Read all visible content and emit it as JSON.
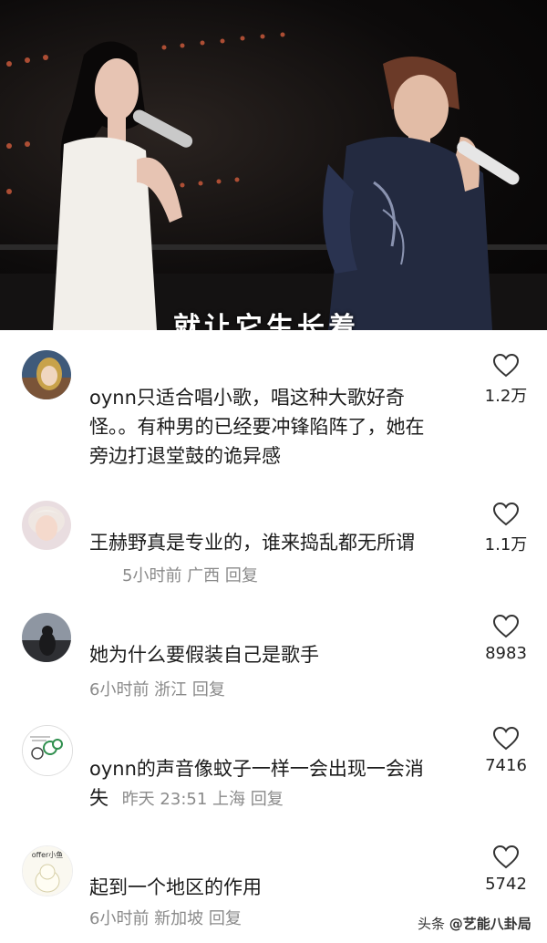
{
  "video": {
    "caption": "就让它生长着"
  },
  "comments": [
    {
      "text_lines": [
        "oynn只适合唱小歌，唱这种大歌好奇",
        "怪。。有种男的已经要冲锋陷阵了，她在",
        "旁边打退堂鼓的诡异感"
      ],
      "meta": "",
      "likes": "1.2万"
    },
    {
      "text_lines": [
        "王赫野真是专业的，谁来捣乱都无所谓"
      ],
      "meta": "5小时前 广西 回复",
      "likes": "1.1万"
    },
    {
      "text_lines": [
        "她为什么要假装自己是歌手"
      ],
      "meta": "6小时前 浙江 回复",
      "likes": "8983"
    },
    {
      "text_lines": [
        "oynn的声音像蚊子一样一会出现一会消",
        "失"
      ],
      "meta": "昨天 23:51 上海 回复",
      "likes": "7416"
    },
    {
      "text_lines": [
        "起到一个地区的作用"
      ],
      "meta": "6小时前 新加坡 回复",
      "likes": "5742"
    }
  ],
  "avatar4_text": "offer小鱼",
  "footer": {
    "platform": "头条",
    "account": "@艺能八卦局"
  },
  "icons": {
    "like": "heart-outline-icon"
  }
}
